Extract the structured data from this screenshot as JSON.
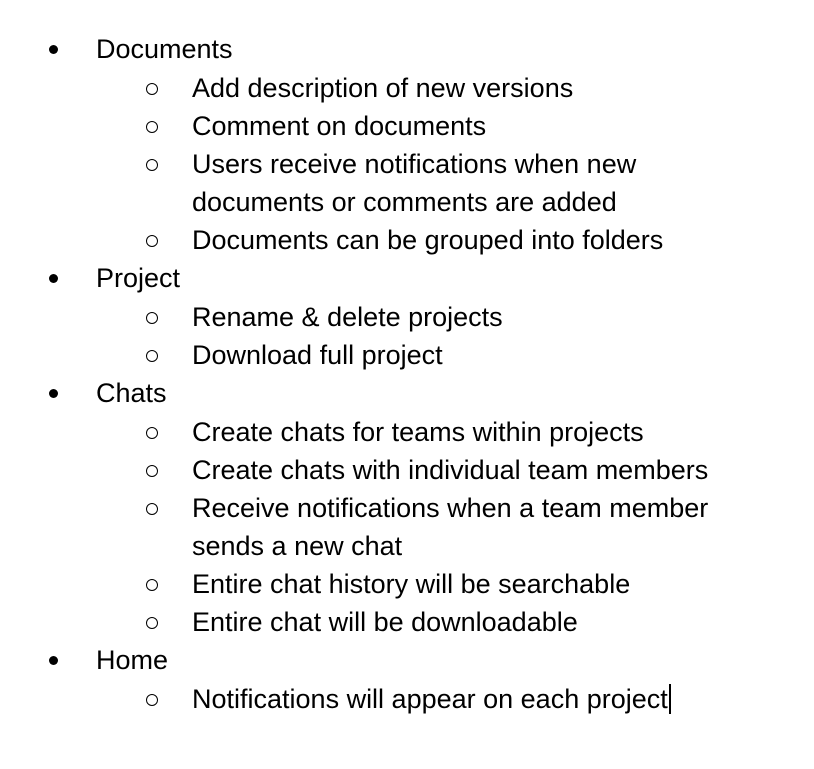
{
  "document": {
    "sections": [
      {
        "heading": "Documents",
        "items": [
          "Add description of new versions",
          "Comment on documents",
          "Users receive notifications when new documents or comments are added",
          "Documents can be grouped into folders"
        ]
      },
      {
        "heading": "Project",
        "items": [
          "Rename & delete projects",
          "Download full project"
        ]
      },
      {
        "heading": "Chats",
        "items": [
          "Create chats for teams within projects",
          "Create chats with individual team members",
          "Receive notifications when a team member sends a new chat",
          "Entire chat history will be searchable",
          "Entire chat will be downloadable"
        ]
      },
      {
        "heading": "Home",
        "items": [
          "Notifications will appear on each project"
        ]
      }
    ],
    "icons": {
      "level1_bullet": "filled-circle-bullet-icon",
      "level2_bullet": "hollow-circle-bullet-icon"
    },
    "cursor_visible": true
  }
}
